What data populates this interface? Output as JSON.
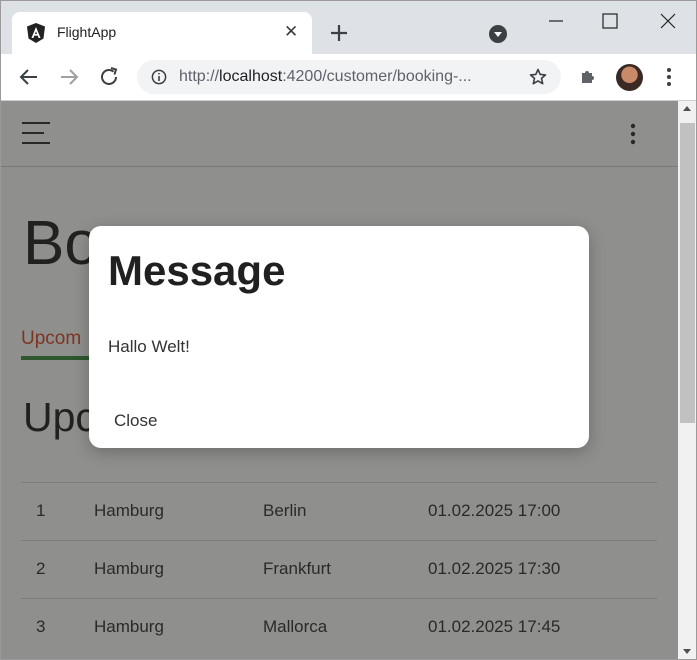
{
  "browser": {
    "tab_title": "FlightApp",
    "url_prefix": "http://",
    "url_host": "localhost",
    "url_rest": ":4200/customer/booking-...",
    "accent": "#dee1e6"
  },
  "app": {
    "page_title": "Bo",
    "tab_label": "Upcom",
    "section_title": "Upc",
    "rows": [
      {
        "no": "1",
        "from": "Hamburg",
        "to": "Berlin",
        "date": "01.02.2025 17:00"
      },
      {
        "no": "2",
        "from": "Hamburg",
        "to": "Frankfurt",
        "date": "01.02.2025 17:30"
      },
      {
        "no": "3",
        "from": "Hamburg",
        "to": "Mallorca",
        "date": "01.02.2025 17:45"
      }
    ]
  },
  "dialog": {
    "title": "Message",
    "body": "Hallo Welt!",
    "close_label": "Close"
  }
}
